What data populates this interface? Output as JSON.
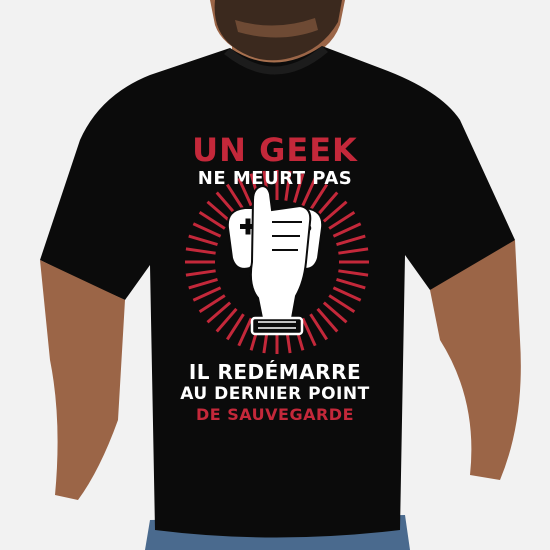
{
  "colors": {
    "background": "#f2f2f2",
    "shirt": "#0b0b0b",
    "accent_red": "#c4283a",
    "print_white": "#ffffff",
    "skin": "#a7704f",
    "hair": "#2a1f18",
    "jeans": "#4a6a8e"
  },
  "design": {
    "line1": "UN GEEK",
    "line2": "NE MEURT PAS",
    "line3": "IL REDÉMARRE",
    "line4": "AU DERNIER POINT",
    "line5": "DE SAUVEGARDE"
  },
  "icons": [
    "fist-holding-gamepad-icon",
    "sunburst-rays"
  ]
}
